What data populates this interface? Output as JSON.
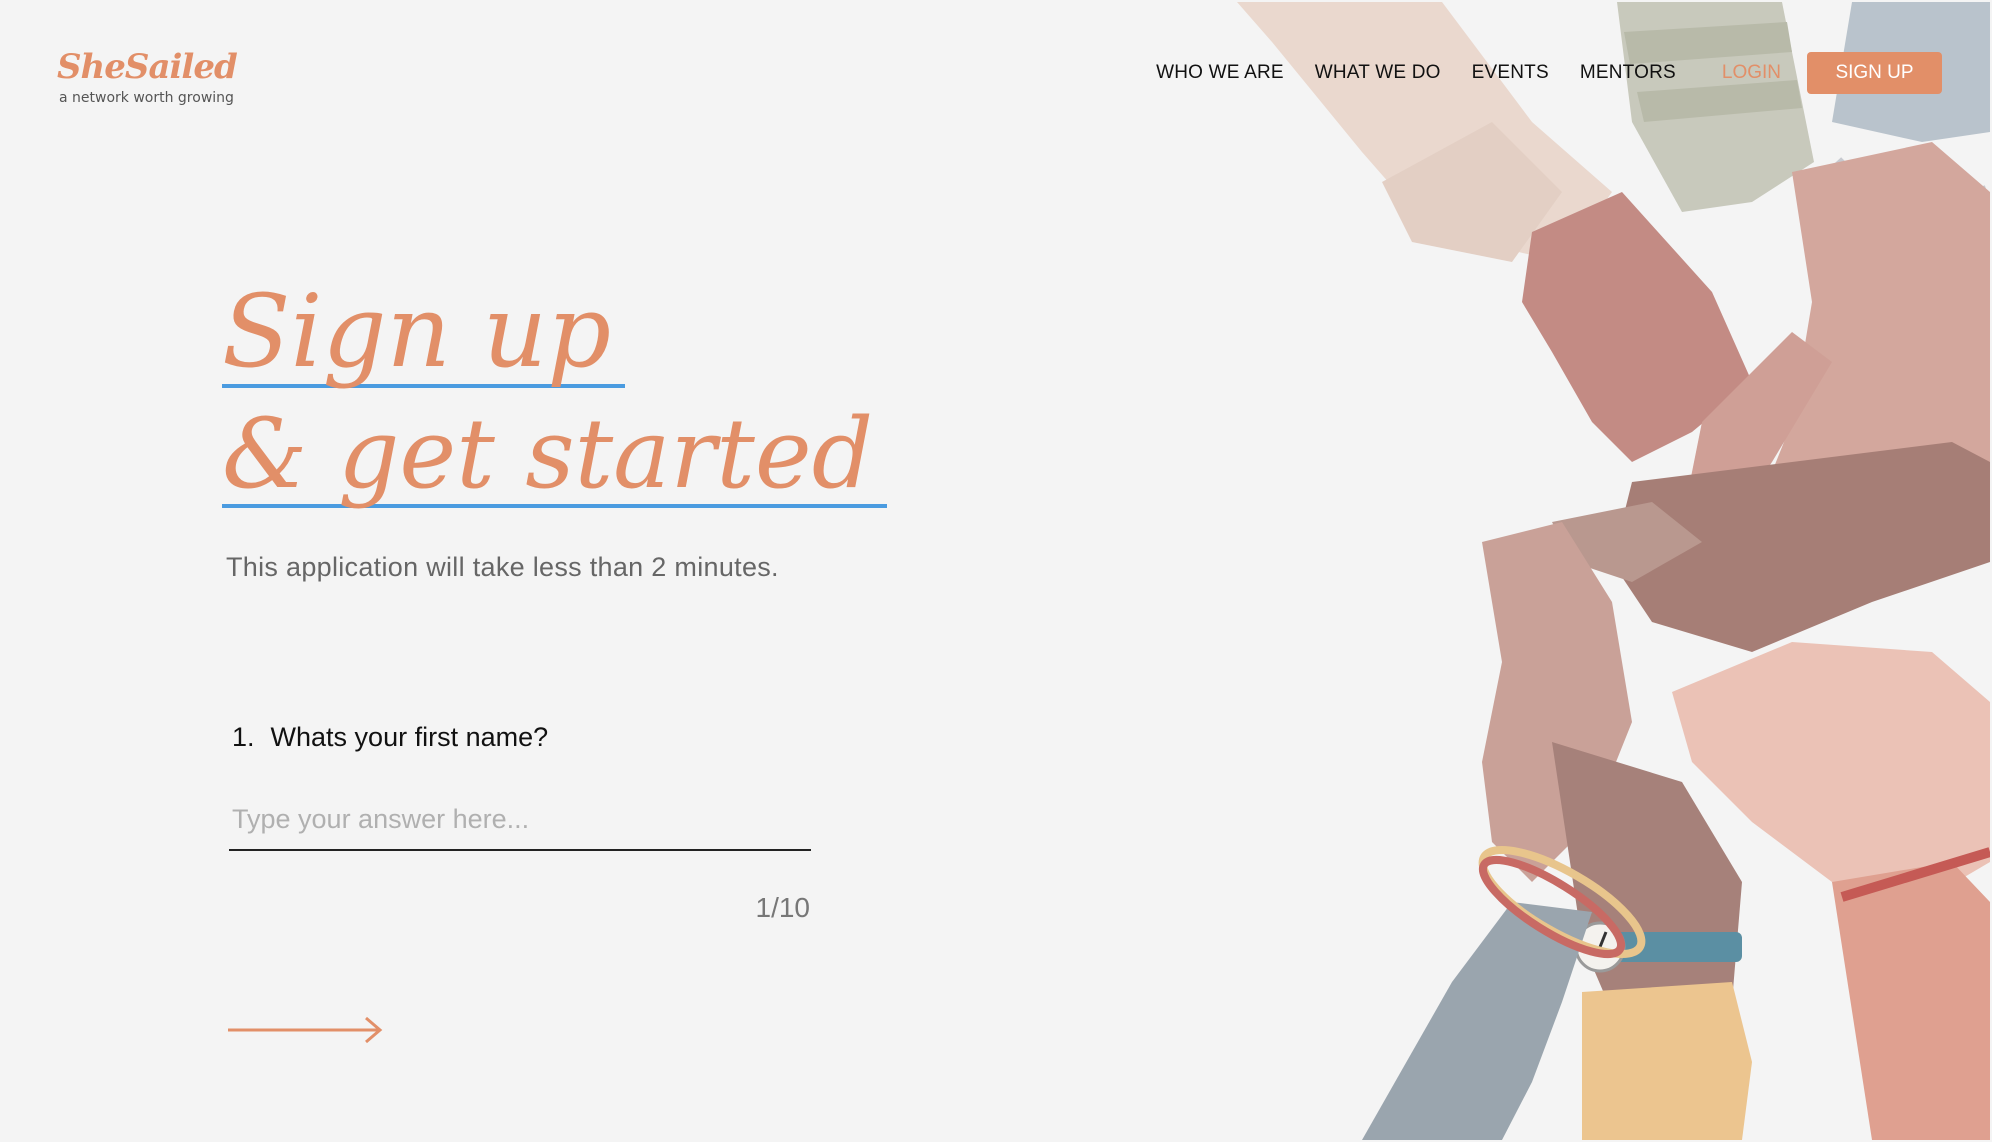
{
  "logo": {
    "name": "SheSailed",
    "tagline": "a network worth growing"
  },
  "nav": {
    "links": [
      "WHO WE ARE",
      "WHAT WE DO",
      "EVENTS",
      "MENTORS"
    ],
    "login": "LOGIN",
    "signup": "SIGN UP"
  },
  "heading": {
    "line1": "Sign up",
    "line2": "& get started"
  },
  "subtitle": "This application will take less than 2 minutes.",
  "question": {
    "number": "1.",
    "text": "Whats your first name?",
    "placeholder": "Type your answer here...",
    "value": ""
  },
  "progress": "1/10",
  "colors": {
    "accent": "#e28f68",
    "underline": "#4a9be0",
    "background": "#f4f4f4"
  },
  "icons": {
    "next": "right-arrow-icon",
    "illustration": "stacked-hands-illustration"
  }
}
